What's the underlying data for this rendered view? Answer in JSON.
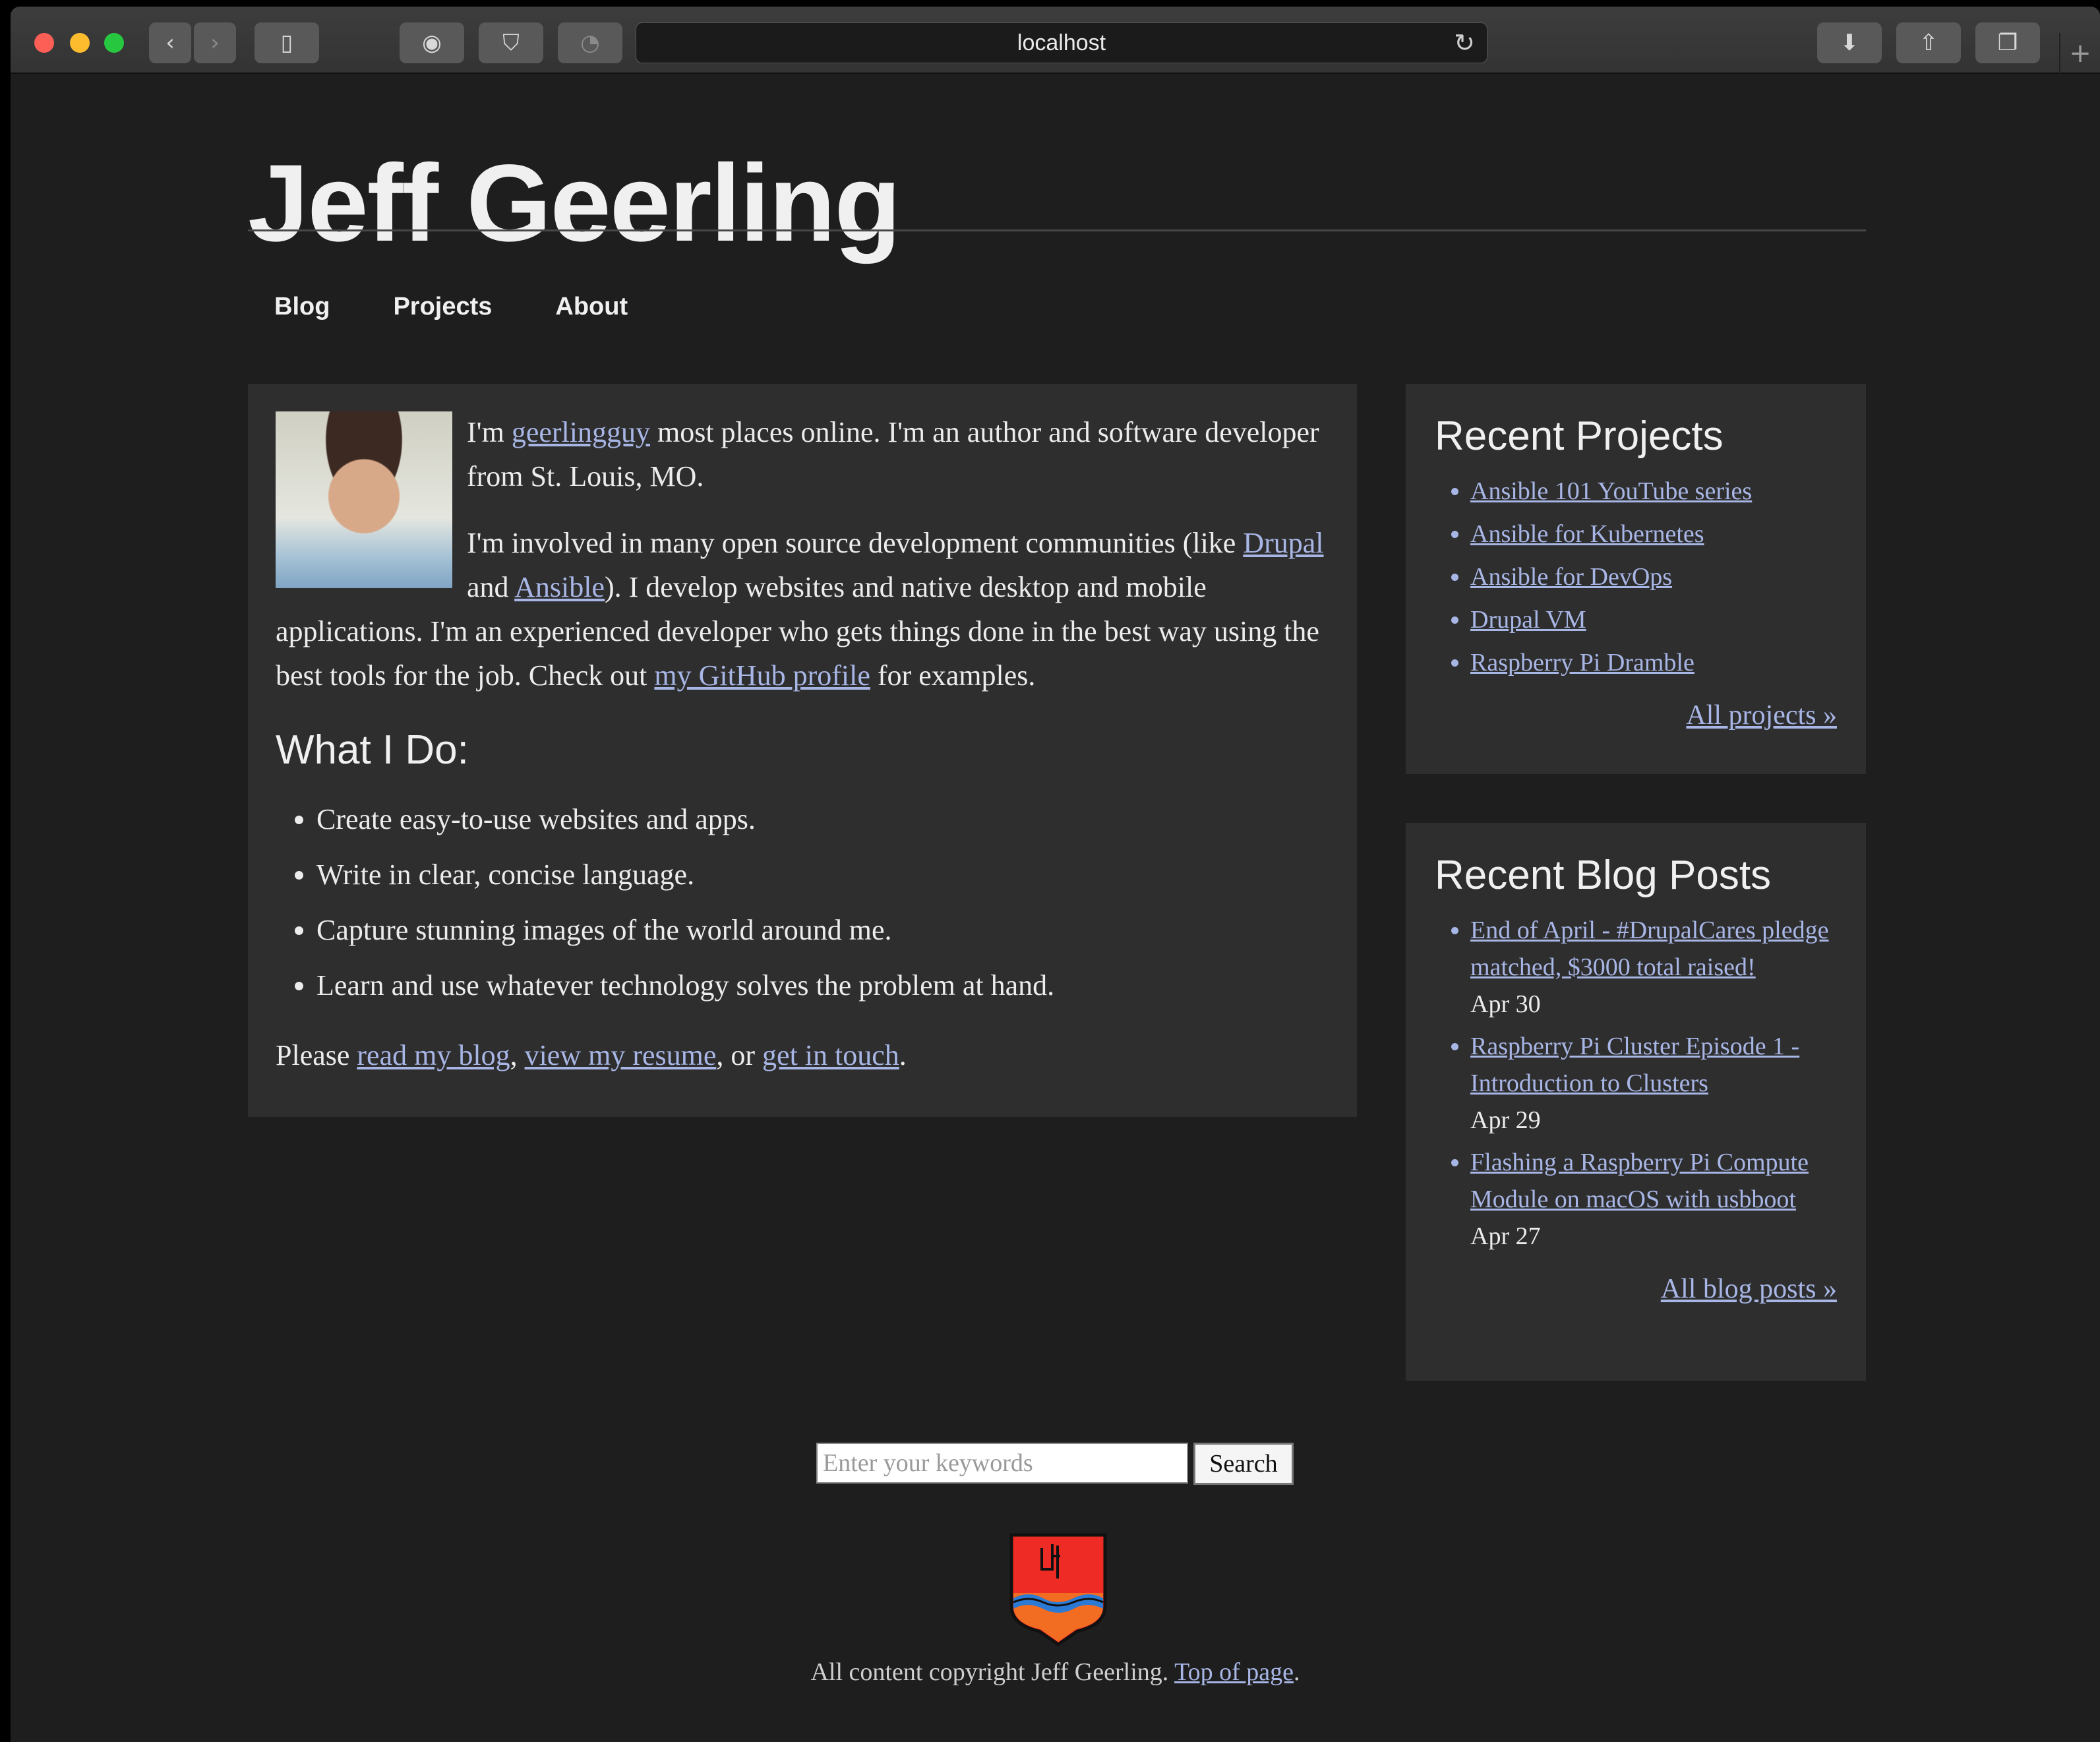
{
  "browser": {
    "url": "localhost"
  },
  "site": {
    "title": "Jeff Geerling",
    "nav": [
      "Blog",
      "Projects",
      "About"
    ]
  },
  "intro": {
    "p1_a": "I'm ",
    "p1_link": "geerlingguy",
    "p1_b": " most places online. I'm an author and software developer from St. Louis, MO.",
    "p2_a": "I'm involved in many open source development communities (like ",
    "p2_link1": "Drupal",
    "p2_b": " and ",
    "p2_link2": "Ansible",
    "p2_c": "). I develop websites and native desktop and mobile applications. I'm an experienced developer who gets things done in the best way using the best tools for the job. Check out ",
    "p2_link3": "my GitHub profile",
    "p2_d": " for examples.",
    "heading": "What I Do:",
    "items": [
      "Create easy-to-use websites and apps.",
      "Write in clear, concise language.",
      "Capture stunning images of the world around me.",
      "Learn and use whatever technology solves the problem at hand."
    ],
    "cta_a": "Please ",
    "cta_link1": "read my blog",
    "cta_b": ", ",
    "cta_link2": "view my resume",
    "cta_c": ", or ",
    "cta_link3": "get in touch",
    "cta_d": "."
  },
  "projects": {
    "heading": "Recent Projects",
    "items": [
      "Ansible 101 YouTube series",
      "Ansible for Kubernetes",
      "Ansible for DevOps",
      "Drupal VM",
      "Raspberry Pi Dramble"
    ],
    "all": "All projects »"
  },
  "posts": {
    "heading": "Recent Blog Posts",
    "items": [
      {
        "title": "End of April - #DrupalCares pledge matched, $3000 total raised!",
        "date": "Apr 30"
      },
      {
        "title": "Raspberry Pi Cluster Episode 1 - Introduction to Clusters",
        "date": "Apr 29"
      },
      {
        "title": "Flashing a Raspberry Pi Compute Module on macOS with usbboot",
        "date": "Apr 27"
      }
    ],
    "all": "All blog posts »"
  },
  "search": {
    "placeholder": "Enter your keywords",
    "button": "Search"
  },
  "footer": {
    "text": "All content copyright Jeff Geerling. ",
    "link": "Top of page",
    "end": "."
  },
  "colors": {
    "background": "#1e1e1e",
    "panel": "#2e2e2e",
    "link": "#a8b6e6",
    "text": "#ececec"
  }
}
